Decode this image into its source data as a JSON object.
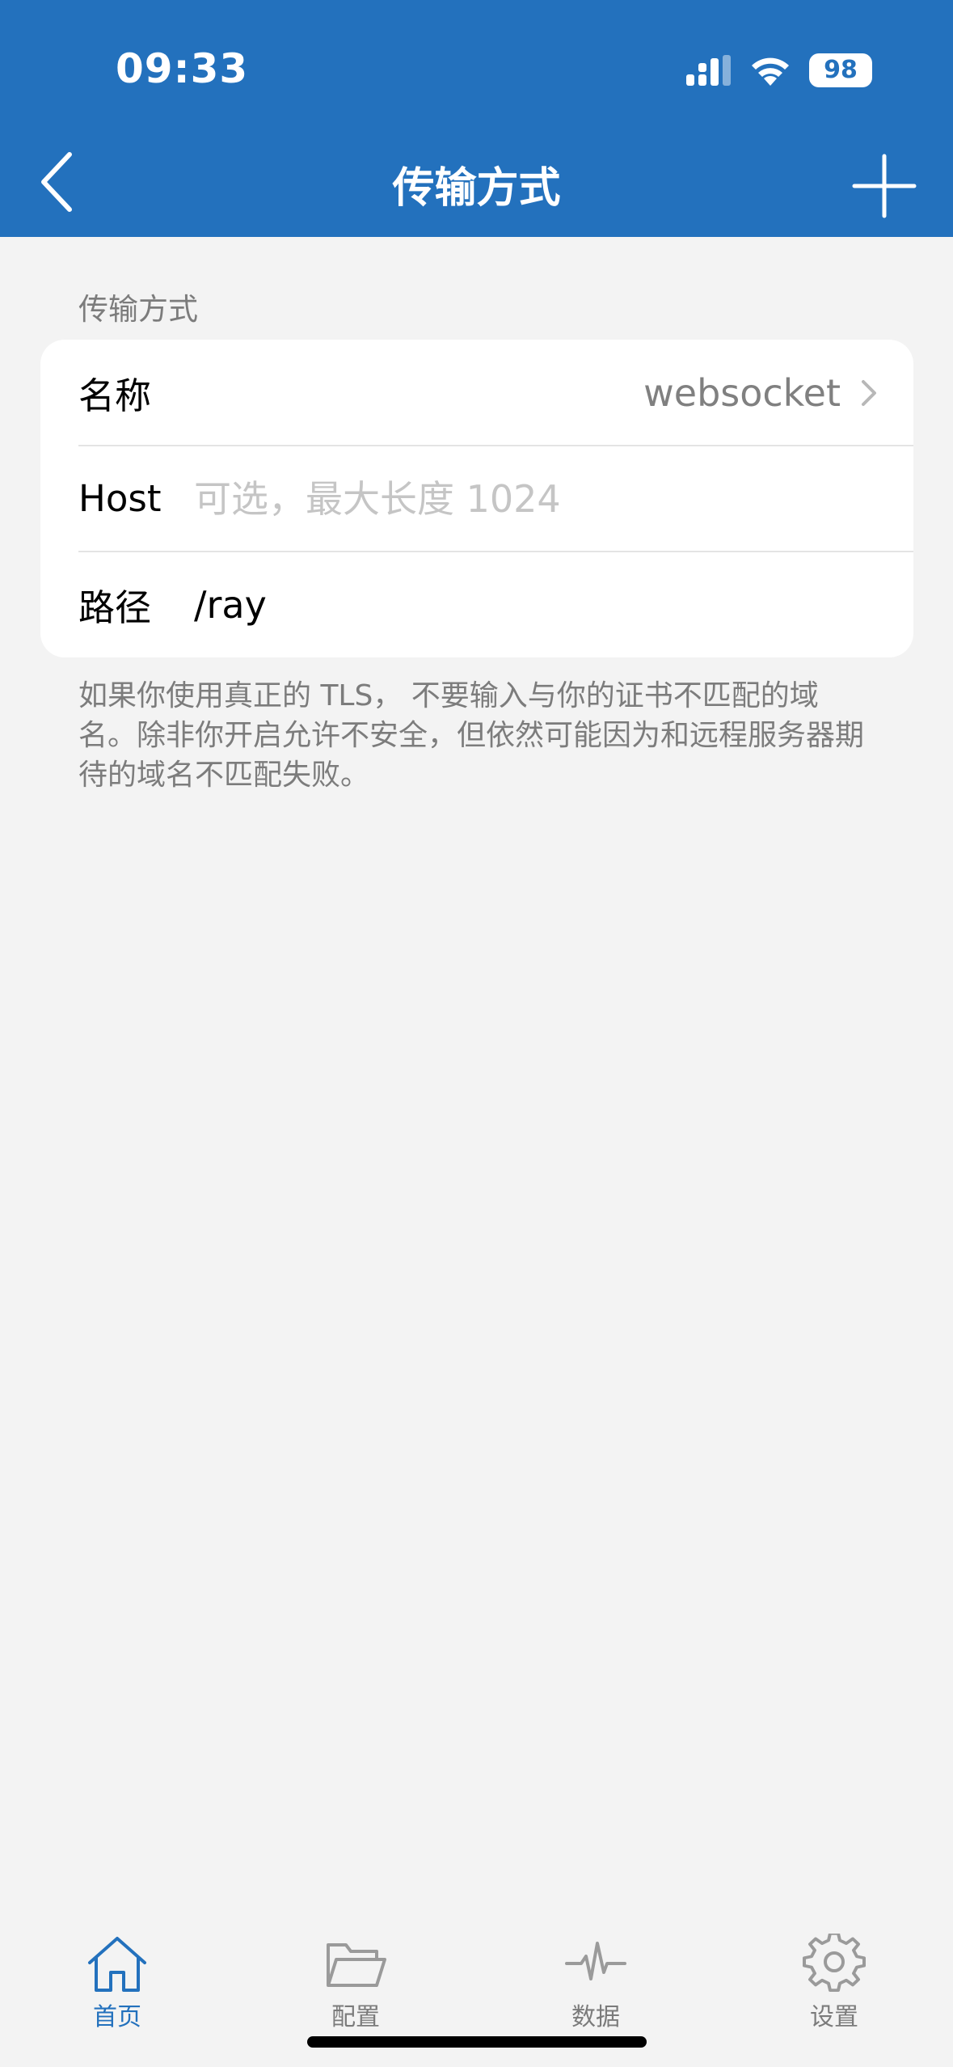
{
  "status_bar": {
    "time": "09:33",
    "battery": "98"
  },
  "nav": {
    "title": "传输方式"
  },
  "section": {
    "header": "传输方式"
  },
  "form": {
    "name": {
      "label": "名称",
      "value": "websocket"
    },
    "host": {
      "label": "Host",
      "value": "",
      "placeholder": "可选，最大长度 1024"
    },
    "path": {
      "label": "路径",
      "value": "/ray"
    }
  },
  "footnote": "如果你使用真正的 TLS， 不要输入与你的证书不匹配的域名。除非你开启允许不安全，但依然可能因为和远程服务器期待的域名不匹配失败。",
  "tabs": [
    {
      "label": "首页",
      "icon": "home-icon",
      "active": true
    },
    {
      "label": "配置",
      "icon": "folder-icon",
      "active": false
    },
    {
      "label": "数据",
      "icon": "pulse-icon",
      "active": false
    },
    {
      "label": "设置",
      "icon": "gear-icon",
      "active": false
    }
  ],
  "colors": {
    "accent": "#2371bd",
    "background": "#f3f3f3"
  }
}
